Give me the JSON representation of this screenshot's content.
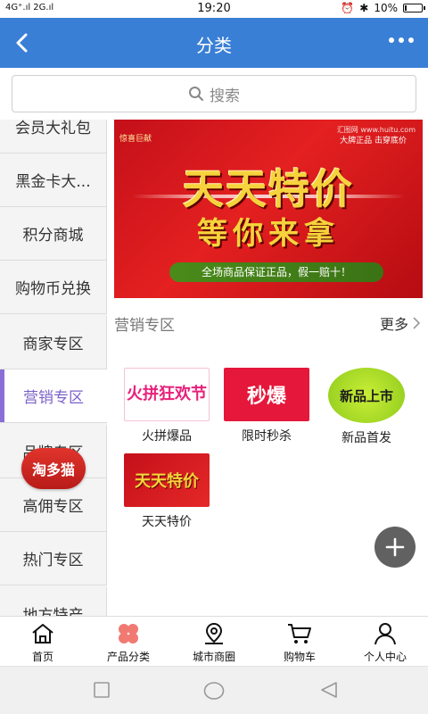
{
  "status_bar": {
    "signal_text": "4G⁺.ıl 2G.ıl",
    "time": "19:20",
    "battery_text": "10%",
    "battery_level": 0.1
  },
  "nav": {
    "title": "分类",
    "back_icon": "chevron-left-icon",
    "more_icon": "more-dots-icon"
  },
  "search": {
    "placeholder": "搜索",
    "icon": "search-icon"
  },
  "sidebar": {
    "items": [
      {
        "label": "会员大礼包"
      },
      {
        "label": "黑金卡大..."
      },
      {
        "label": "积分商城"
      },
      {
        "label": "购物币兑换"
      },
      {
        "label": "商家专区"
      },
      {
        "label": "营销专区"
      },
      {
        "label": "品牌专区"
      },
      {
        "label": "高佣专区"
      },
      {
        "label": "热门专区"
      },
      {
        "label": "地方特产"
      }
    ],
    "active_index": 5
  },
  "banner": {
    "tag_left": "惊喜巨献",
    "tag_right_small": "汇图网 www.huitu.com",
    "tag_right": "大牌正品 击穿底价",
    "main_text": "天天特价",
    "sub_text": "等你来拿",
    "pill_text": "全场商品保证正品，假一赔十！"
  },
  "section": {
    "title": "营销专区",
    "more_label": "更多"
  },
  "products": [
    {
      "name": "火拼爆品",
      "thumb_text": "火拼狂欢节"
    },
    {
      "name": "限时秒杀",
      "thumb_text": "秒爆"
    },
    {
      "name": "新品首发",
      "thumb_text": "新品上市"
    },
    {
      "name": "天天特价",
      "thumb_text": "天天特价"
    }
  ],
  "floating_badge": {
    "label": "淘多猫"
  },
  "fab": {
    "icon": "plus-icon"
  },
  "tab_bar": {
    "items": [
      {
        "label": "首页",
        "icon": "home-icon"
      },
      {
        "label": "产品分类",
        "icon": "category-icon"
      },
      {
        "label": "城市商圈",
        "icon": "location-icon"
      },
      {
        "label": "购物车",
        "icon": "cart-icon"
      },
      {
        "label": "个人中心",
        "icon": "user-icon"
      }
    ],
    "active_index": 1,
    "accent": "#f07a72"
  },
  "colors": {
    "nav_bg": "#3a7fd6",
    "active_side": "#7b63c9"
  }
}
